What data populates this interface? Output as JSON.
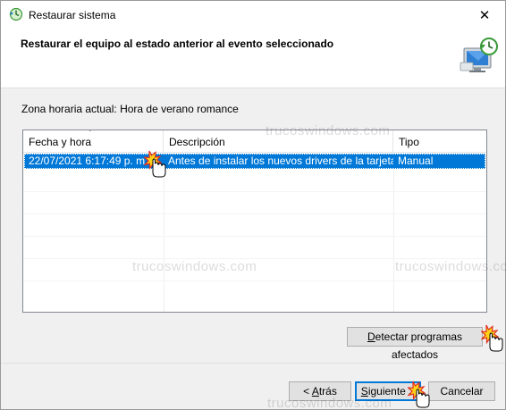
{
  "window": {
    "title": "Restaurar sistema",
    "close_glyph": "✕"
  },
  "header": {
    "heading": "Restaurar el equipo al estado anterior al evento seleccionado",
    "icon": "system-restore-monitor-icon"
  },
  "timezone_text": "Zona horaria actual: Hora de verano romance",
  "table": {
    "columns": [
      "Fecha y hora",
      "Descripción",
      "Tipo"
    ],
    "sort_indicator": "⌄",
    "rows": [
      {
        "date": "22/07/2021 6:17:49 p. m.",
        "description": "Antes de instalar los nuevos drivers de la tarjeta...",
        "type": "Manual",
        "selected": true
      }
    ]
  },
  "buttons": {
    "detect": {
      "prefix": "",
      "accel": "D",
      "rest": "etectar programas afectados"
    },
    "back": {
      "prefix": "< ",
      "accel": "A",
      "rest": "trás"
    },
    "next": {
      "prefix": "",
      "accel": "S",
      "rest": "iguiente >"
    },
    "cancel": "Cancelar"
  },
  "watermark": "trucoswindows.com",
  "colors": {
    "selection": "#0078d7",
    "button_face": "#e1e1e1",
    "button_border": "#adadad",
    "default_button_border": "#0078d7"
  }
}
